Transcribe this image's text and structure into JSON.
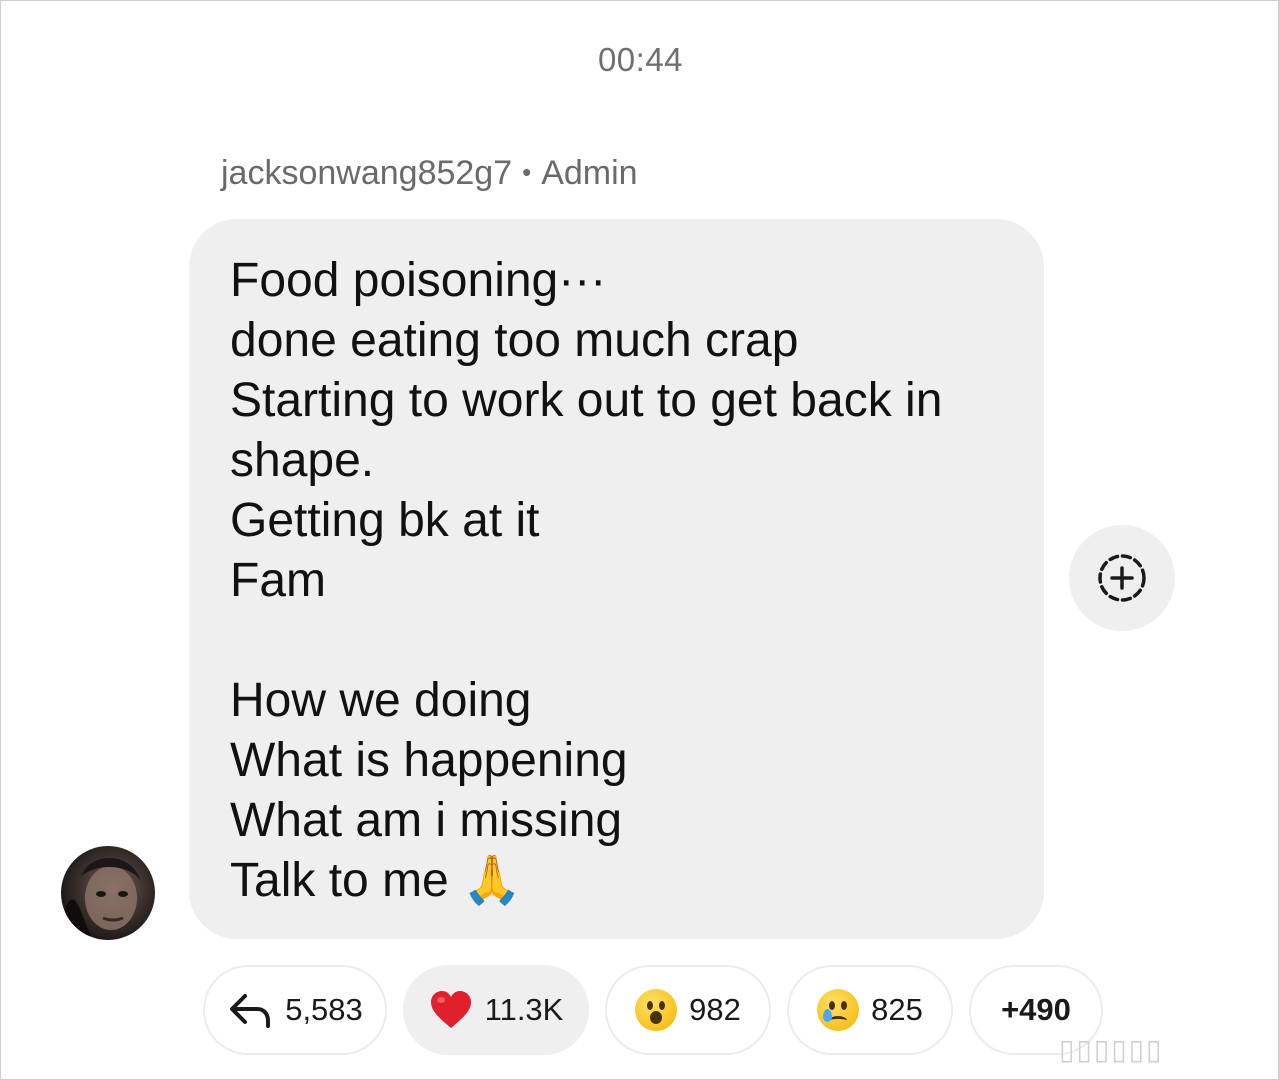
{
  "timestamp": "00:44",
  "sender": {
    "username": "jacksonwang852g7",
    "separator": "•",
    "role": "Admin"
  },
  "message": {
    "lines": [
      "Food poisoning···",
      "done eating too much crap",
      "Starting to work out to get back in",
      "shape.",
      "Getting bk at it",
      "Fam",
      "",
      "How we doing",
      "What is happening",
      "What am i missing",
      "Talk to me 🙏"
    ]
  },
  "icons": {
    "add_reaction": "add-reaction-icon",
    "reply": "reply-arrow-icon",
    "heart": "red-heart-emoji",
    "surprised": "surprised-face-emoji",
    "crying": "crying-face-emoji"
  },
  "reactions": {
    "replies": "5,583",
    "heart": "11.3K",
    "surprised": "982",
    "crying": "825",
    "more": "+490"
  },
  "colors": {
    "bubble": "#efefef",
    "heart": "#e0202a",
    "meta_text": "#6a6a6a"
  }
}
